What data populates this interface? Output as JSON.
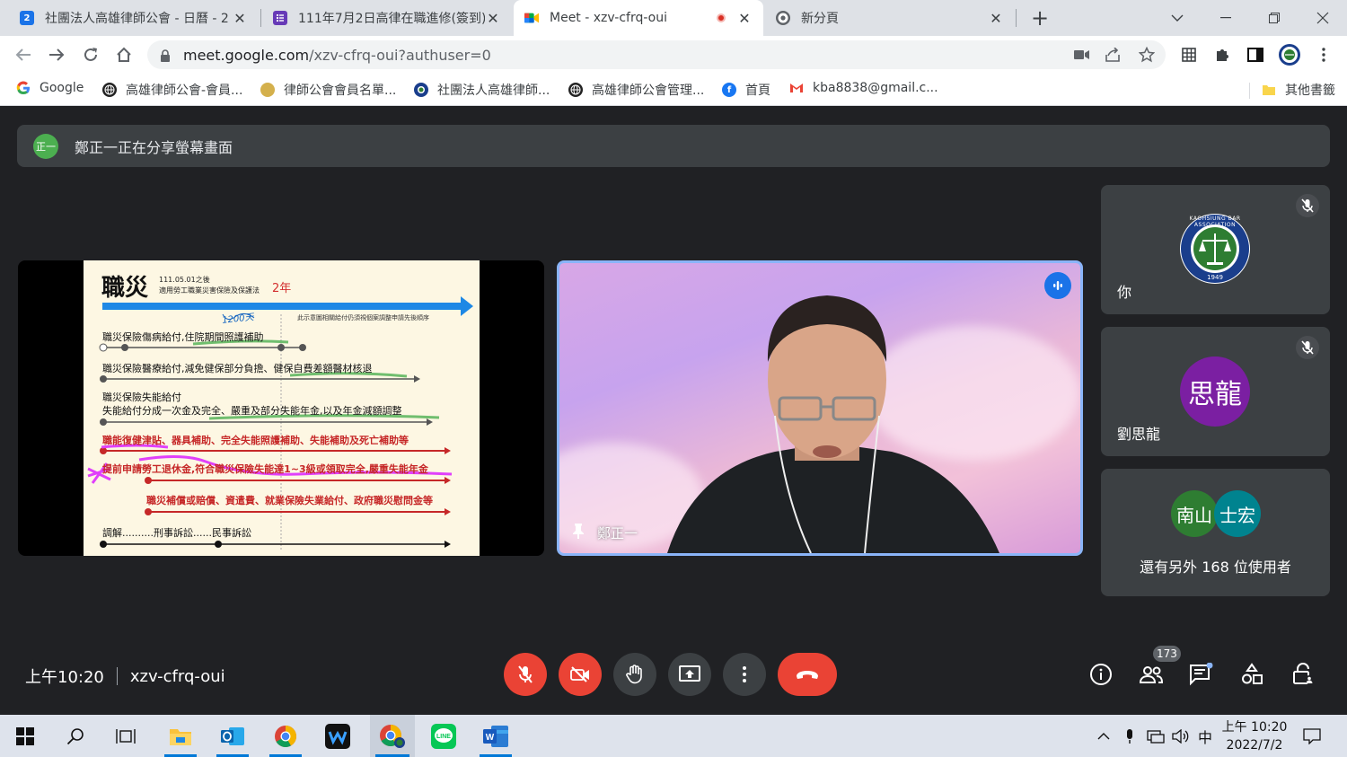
{
  "browser": {
    "tabs": [
      {
        "title": "社團法人高雄律師公會 - 日曆 - 2",
        "icon": "calendar-icon",
        "icon_label": "2",
        "color": "#1a73e8"
      },
      {
        "title": "111年7月2日高律在職進修(簽到)",
        "icon": "forms-icon",
        "color": "#673ab7"
      },
      {
        "title": "Meet - xzv-cfrq-oui",
        "icon": "meet-icon",
        "color": "#00897b",
        "active": true,
        "recording": true
      },
      {
        "title": "新分頁",
        "icon": "chrome-icon",
        "color": "#5f6368"
      }
    ],
    "url_host": "meet.google.com",
    "url_path": "/xzv-cfrq-oui?authuser=0",
    "bookmarks": [
      {
        "label": "Google",
        "icon": "google-icon"
      },
      {
        "label": "高雄律師公會-會員...",
        "icon": "globe-icon"
      },
      {
        "label": "律師公會會員名單...",
        "icon": "seal-icon"
      },
      {
        "label": "社團法人高雄律師...",
        "icon": "seal-icon"
      },
      {
        "label": "高雄律師公會管理...",
        "icon": "globe-icon"
      },
      {
        "label": "首頁",
        "icon": "facebook-icon"
      },
      {
        "label": "kba8838@gmail.c...",
        "icon": "gmail-icon"
      }
    ],
    "other_bookmarks": "其他書籤"
  },
  "meet": {
    "presenting_banner": "鄭正一正在分享螢幕畫面",
    "presenter_avatar": "正一",
    "slide": {
      "title": "職災",
      "note_line1": "111.05.01之後",
      "note_line2": "適用勞工職業災害保險及保護法",
      "two_years": "2年",
      "sub_note": "此示意圖相關給付仍須視個案調整申請先後順序",
      "handwriting": "1200天",
      "rows": [
        {
          "text": "職災保險傷病給付,住院期間照護補助",
          "red": false
        },
        {
          "text": "職災保險醫療給付,減免健保部分負擔、健保自費差額醫材核退",
          "red": false
        },
        {
          "text": "職災保險失能給付",
          "red": false
        },
        {
          "text": "失能給付分成一次金及完全、嚴重及部分失能年金,以及年金減額調整",
          "red": false
        },
        {
          "text": "職能復健津貼、器具補助、完全失能照護補助、失能補助及死亡補助等",
          "red": true
        },
        {
          "text": "提前申請勞工退休金,符合職災保險失能達1~3級或領取完全,嚴重失能年金",
          "red": true
        },
        {
          "text": "職災補償或賠償、資遣費、就業保險失業給付、政府職災慰問金等",
          "red": true
        },
        {
          "text": "調解..........刑事訴訟......民事訴訟",
          "red": false
        }
      ]
    },
    "speaker_name": "鄭正一",
    "participants": [
      {
        "label": "你",
        "avatar_type": "logo",
        "logo_text": "KAOHSIUNG BAR ASSOCIATION",
        "logo_year": "1949",
        "muted": true
      },
      {
        "label": "劉思龍",
        "avatar_text": "思龍",
        "avatar_color": "#7b1fa2",
        "muted": true
      }
    ],
    "others": {
      "avatars": [
        {
          "text": "南山",
          "color": "#2e7d32"
        },
        {
          "text": "士宏",
          "color": "#00838f"
        }
      ],
      "label": "還有另外 168 位使用者"
    },
    "time": "上午10:20",
    "meeting_code": "xzv-cfrq-oui",
    "participant_count": "173"
  },
  "taskbar": {
    "ime": "中",
    "clock_time": "上午 10:20",
    "clock_date": "2022/7/2"
  }
}
